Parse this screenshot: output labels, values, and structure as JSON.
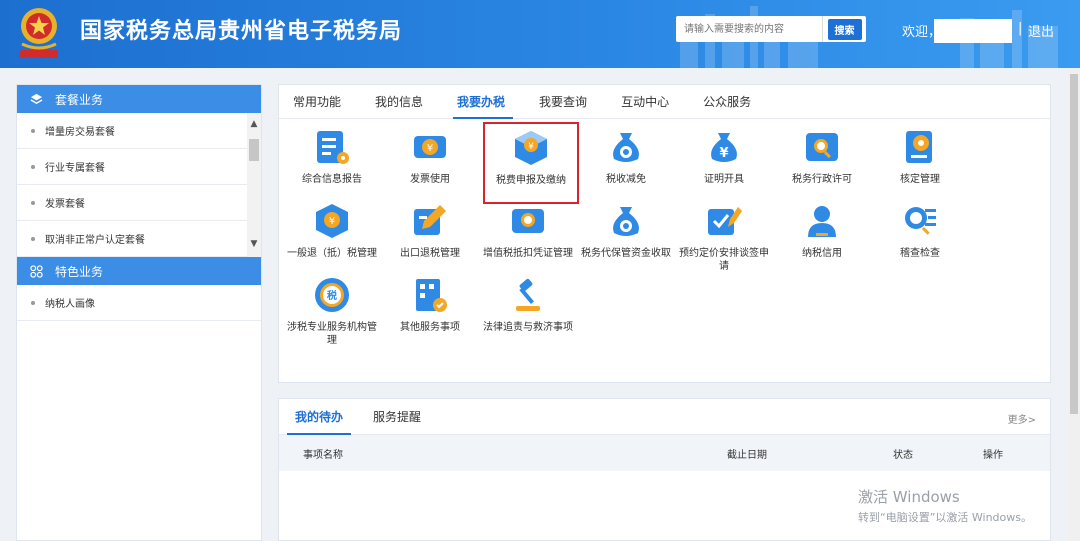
{
  "header": {
    "title": "国家税务总局贵州省电子税务局",
    "search_placeholder": "请输入需要搜索的内容",
    "search_label": "搜索",
    "welcome": "欢迎，",
    "separator": "|",
    "logout": "退出"
  },
  "sidebar": {
    "section1": {
      "title": "套餐业务",
      "icon": "layers-icon"
    },
    "items1": [
      "增量房交易套餐",
      "行业专属套餐",
      "发票套餐",
      "取消非正常户认定套餐"
    ],
    "section2": {
      "title": "特色业务",
      "icon": "grid-icon"
    },
    "items2": [
      "纳税人画像"
    ]
  },
  "panel": {
    "tabs": [
      "常用功能",
      "我的信息",
      "我要办税",
      "我要查询",
      "互动中心",
      "公众服务"
    ],
    "active_tab": 2,
    "services": [
      {
        "label": "综合信息报告",
        "icon": "report-icon"
      },
      {
        "label": "发票使用",
        "icon": "invoice-icon"
      },
      {
        "label": "税费申报及缴纳",
        "icon": "tax-declare-icon"
      },
      {
        "label": "税收减免",
        "icon": "money-bag-icon"
      },
      {
        "label": "证明开具",
        "icon": "certificate-icon"
      },
      {
        "label": "税务行政许可",
        "icon": "search-doc-icon"
      },
      {
        "label": "核定管理",
        "icon": "gear-doc-icon"
      },
      {
        "label": "一般退（抵）税管理",
        "icon": "refund-icon"
      },
      {
        "label": "出口退税管理",
        "icon": "edit-icon"
      },
      {
        "label": "增值税抵扣凭证管理",
        "icon": "voucher-search-icon"
      },
      {
        "label": "税务代保管资金收取",
        "icon": "money-bag-icon"
      },
      {
        "label": "预约定价安排谈签申请",
        "icon": "check-edit-icon"
      },
      {
        "label": "纳税信用",
        "icon": "user-icon"
      },
      {
        "label": "稽查检查",
        "icon": "inspect-icon"
      },
      {
        "label": "涉税专业服务机构管理",
        "icon": "tax-seal-icon"
      },
      {
        "label": "其他服务事项",
        "icon": "building-icon"
      },
      {
        "label": "法律追责与救济事项",
        "icon": "gavel-icon"
      }
    ]
  },
  "todo": {
    "tabs": [
      "我的待办",
      "服务提醒"
    ],
    "more": "更多>",
    "columns": [
      "事项名称",
      "截止日期",
      "状态",
      "操作"
    ]
  },
  "watermark": {
    "line1": "激活 Windows",
    "line2": "转到“电脑设置”以激活 Windows。"
  },
  "colors": {
    "primary": "#1e6fd6",
    "header": "#2a86e3",
    "highlight": "#d9232e"
  }
}
